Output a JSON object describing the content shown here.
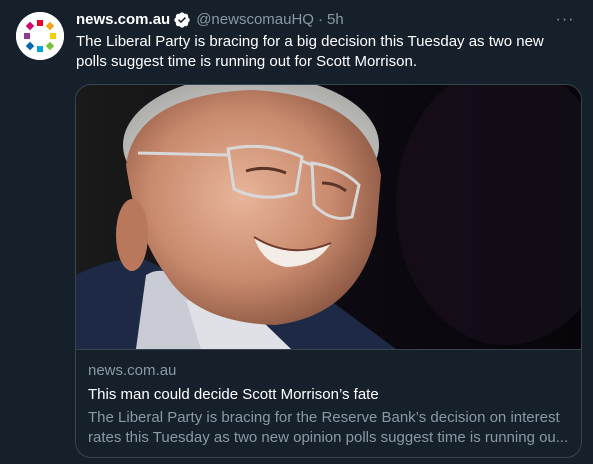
{
  "tweet": {
    "author": {
      "display_name": "news.com.au",
      "handle": "@newscomauHQ",
      "verified_icon": "verified-badge-icon",
      "avatar_icon": "news-com-au-logo"
    },
    "separator": "·",
    "time": "5h",
    "more_icon": "more-options-icon",
    "more_label": "···",
    "text": "The Liberal Party is bracing for a big decision this Tuesday as two new polls suggest time is running out for Scott Morrison."
  },
  "card": {
    "domain": "news.com.au",
    "title": "This man could decide Scott Morrison’s fate",
    "description": "The Liberal Party is bracing for the Reserve Bank’s decision on interest rates this Tuesday as two new opinion polls suggest time is running ou..."
  },
  "colors": {
    "background": "#15202b",
    "border": "#38444d",
    "secondary_text": "#8b98a5",
    "verified": "#ffffff"
  }
}
